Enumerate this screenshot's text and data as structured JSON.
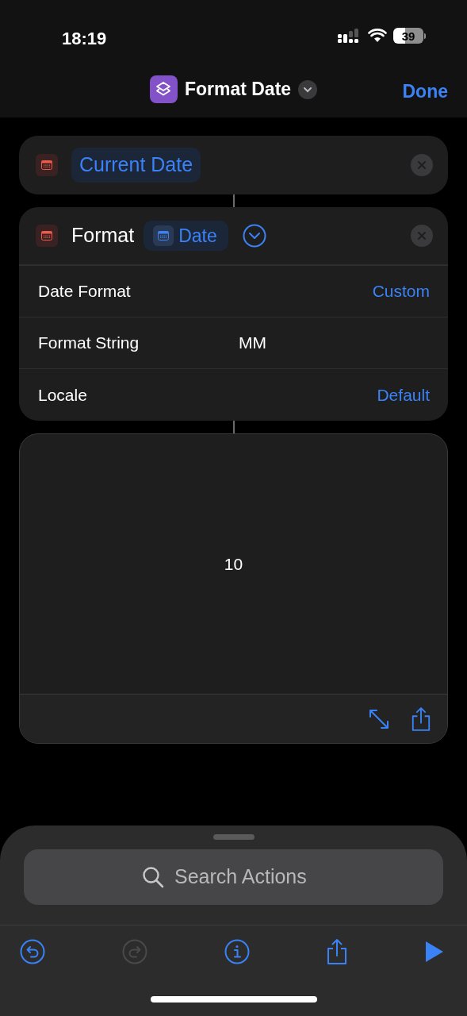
{
  "status_bar": {
    "time": "18:19",
    "battery": "39"
  },
  "nav": {
    "title": "Format Date",
    "done": "Done"
  },
  "actions": [
    {
      "kind": "plain",
      "token": "Current Date"
    },
    {
      "kind": "format",
      "label": "Format",
      "token": "Date",
      "expanded": true,
      "rows": [
        {
          "label": "Date Format",
          "value": "Custom",
          "kind": "link"
        },
        {
          "label": "Format String",
          "value": "MM",
          "kind": "text"
        },
        {
          "label": "Locale",
          "value": "Default",
          "kind": "link"
        }
      ]
    }
  ],
  "result": {
    "text": "10"
  },
  "search": {
    "placeholder": "Search Actions"
  },
  "toolbar": [
    {
      "kind": "undo",
      "disabled": false
    },
    {
      "kind": "redo",
      "disabled": true
    },
    {
      "kind": "info",
      "disabled": false
    },
    {
      "kind": "share",
      "disabled": false
    },
    {
      "kind": "run",
      "disabled": false
    }
  ]
}
